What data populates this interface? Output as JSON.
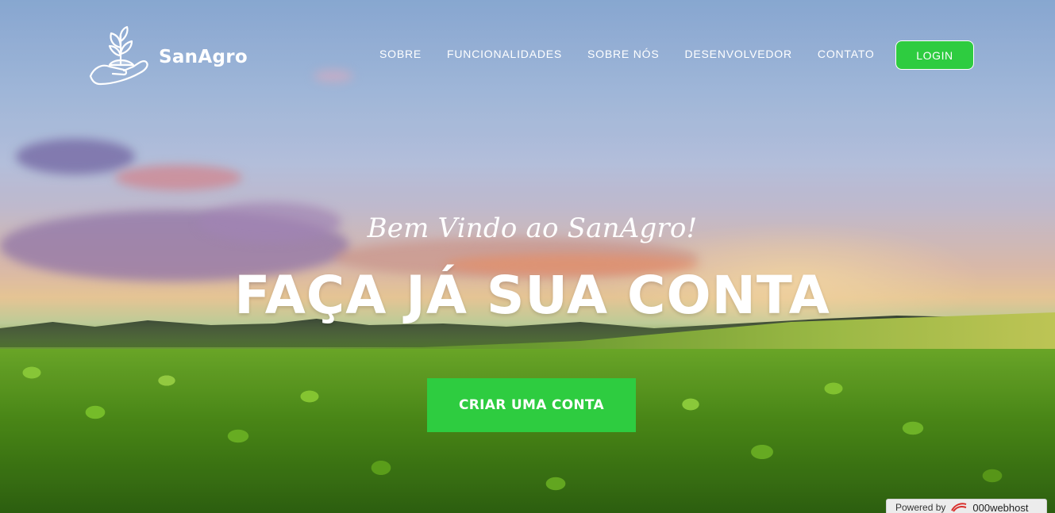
{
  "brand": {
    "name": "SanAgro",
    "logo_icon": "plant-in-hand-icon"
  },
  "nav": {
    "items": [
      {
        "label": "SOBRE"
      },
      {
        "label": "FUNCIONALIDADES"
      },
      {
        "label": "SOBRE NÓS"
      },
      {
        "label": "DESENVOLVEDOR"
      },
      {
        "label": "CONTATO"
      }
    ],
    "login_label": "LOGIN"
  },
  "hero": {
    "welcome": "Bem Vindo ao SanAgro!",
    "headline": "FAÇA JÁ SUA CONTA",
    "cta_label": "CRIAR UMA CONTA"
  },
  "footer_badge": {
    "prefix": "Powered by",
    "brand": "000webhost"
  },
  "colors": {
    "accent": "#2ecc40",
    "text": "#ffffff"
  }
}
